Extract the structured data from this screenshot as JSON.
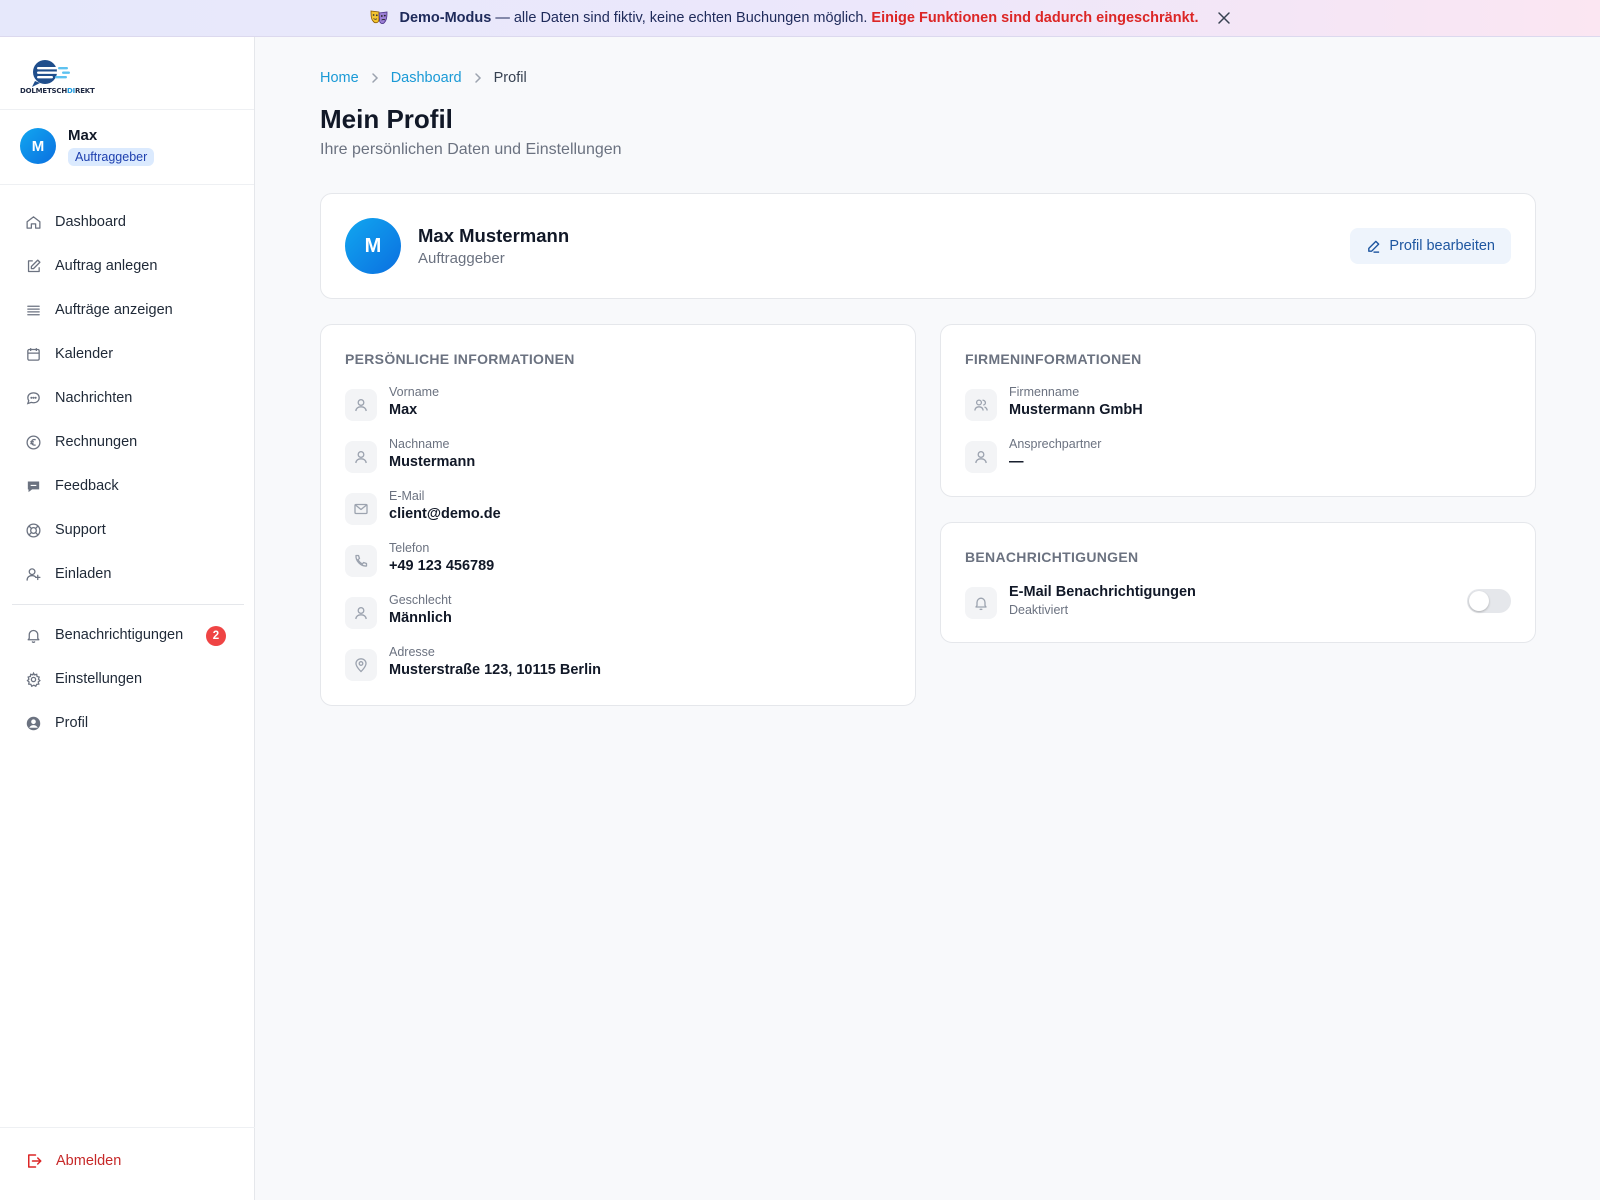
{
  "banner": {
    "mode": "Demo-Modus",
    "text": "— alle Daten sind fiktiv, keine echten Buchungen möglich.",
    "warning": "Einige Funktionen sind dadurch eingeschränkt."
  },
  "logo": {
    "text_main": "DOLMETSCH",
    "text_accent": "DI",
    "text_end": "REKT"
  },
  "user": {
    "name": "Max",
    "initial": "M",
    "role": "Auftraggeber"
  },
  "sidebar": {
    "items": [
      {
        "label": "Dashboard",
        "icon": "home-icon"
      },
      {
        "label": "Auftrag anlegen",
        "icon": "edit-icon"
      },
      {
        "label": "Aufträge anzeigen",
        "icon": "list-icon"
      },
      {
        "label": "Kalender",
        "icon": "calendar-icon"
      },
      {
        "label": "Nachrichten",
        "icon": "chat-icon"
      },
      {
        "label": "Rechnungen",
        "icon": "euro-icon"
      },
      {
        "label": "Feedback",
        "icon": "feedback-icon"
      },
      {
        "label": "Support",
        "icon": "lifebuoy-icon"
      },
      {
        "label": "Einladen",
        "icon": "user-plus-icon"
      }
    ],
    "secondary": [
      {
        "label": "Benachrichtigungen",
        "icon": "bell-icon",
        "badge": "2"
      },
      {
        "label": "Einstellungen",
        "icon": "gear-icon"
      },
      {
        "label": "Profil",
        "icon": "user-circle-icon"
      }
    ],
    "logout": "Abmelden"
  },
  "breadcrumb": {
    "home": "Home",
    "dashboard": "Dashboard",
    "current": "Profil"
  },
  "page": {
    "title": "Mein Profil",
    "subtitle": "Ihre persönlichen Daten und Einstellungen"
  },
  "profile": {
    "initial": "M",
    "full_name": "Max Mustermann",
    "role": "Auftraggeber",
    "edit_label": "Profil bearbeiten"
  },
  "personal": {
    "title": "PERSÖNLICHE INFORMATIONEN",
    "fields": [
      {
        "label": "Vorname",
        "value": "Max"
      },
      {
        "label": "Nachname",
        "value": "Mustermann"
      },
      {
        "label": "E-Mail",
        "value": "client@demo.de"
      },
      {
        "label": "Telefon",
        "value": "+49 123 456789"
      },
      {
        "label": "Geschlecht",
        "value": "Männlich"
      },
      {
        "label": "Adresse",
        "value": "Musterstraße 123, 10115 Berlin"
      }
    ]
  },
  "company": {
    "title": "FIRMENINFORMATIONEN",
    "fields": [
      {
        "label": "Firmenname",
        "value": "Mustermann GmbH"
      },
      {
        "label": "Ansprechpartner",
        "value": "—"
      }
    ]
  },
  "notifications": {
    "title": "BENACHRICHTIGUNGEN",
    "email_label": "E-Mail Benachrichtigungen",
    "email_status": "Deaktiviert",
    "email_enabled": false
  },
  "colors": {
    "accent": "#1a9ad6",
    "avatar": "#0b6fe0",
    "danger": "#dc2626",
    "badge_bg": "#dbeafe"
  }
}
